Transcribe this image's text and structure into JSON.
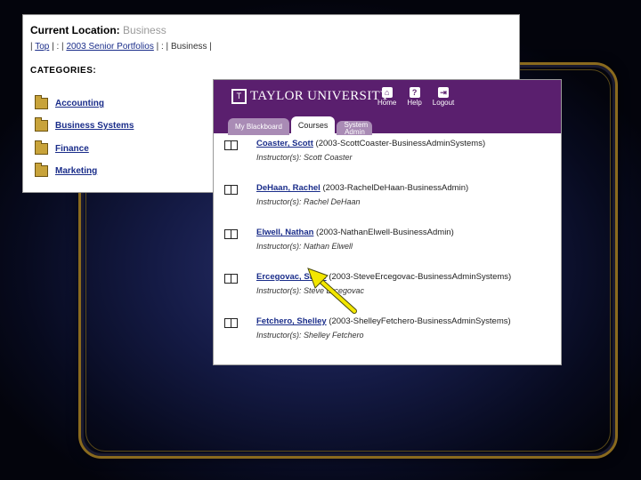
{
  "panel_a": {
    "location_label": "Current Location:",
    "location_value": "Business",
    "crumbs": [
      "Top",
      "2003 Senior Portfolios",
      "Business"
    ],
    "crumb_sep_1": "|",
    "crumb_sep_2": "| : |",
    "crumb_sep_3": "| : |",
    "crumb_sep_4": "|",
    "categories_heading": "CATEGORIES:",
    "categories": [
      "Accounting",
      "Business Systems",
      "Finance",
      "Marketing"
    ]
  },
  "panel_b": {
    "logo_text": "TAYLOR UNIVERSITY",
    "top_links": [
      "Home",
      "Help",
      "Logout"
    ],
    "tabs": [
      "My Blackboard",
      "Courses",
      "System Admin"
    ],
    "courses": [
      {
        "name": "Coaster, Scott",
        "code": "(2003-ScottCoaster-BusinessAdminSystems)",
        "instructor": "Instructor(s): Scott Coaster"
      },
      {
        "name": "DeHaan, Rachel",
        "code": "(2003-RachelDeHaan-BusinessAdmin)",
        "instructor": "Instructor(s): Rachel DeHaan"
      },
      {
        "name": "Elwell, Nathan",
        "code": "(2003-NathanElwell-BusinessAdmin)",
        "instructor": "Instructor(s): Nathan Elwell"
      },
      {
        "name": "Ercegovac, Steve",
        "code": "(2003-SteveErcegovac-BusinessAdminSystems)",
        "instructor": "Instructor(s): Steve Ercegovac"
      },
      {
        "name": "Fetchero, Shelley",
        "code": "(2003-ShelleyFetchero-BusinessAdminSystems)",
        "instructor": "Instructor(s): Shelley Fetchero"
      }
    ]
  },
  "colors": {
    "header_purple": "#5a1f6e",
    "link_blue": "#1a2d8a",
    "arrow_yellow": "#f2e600"
  }
}
